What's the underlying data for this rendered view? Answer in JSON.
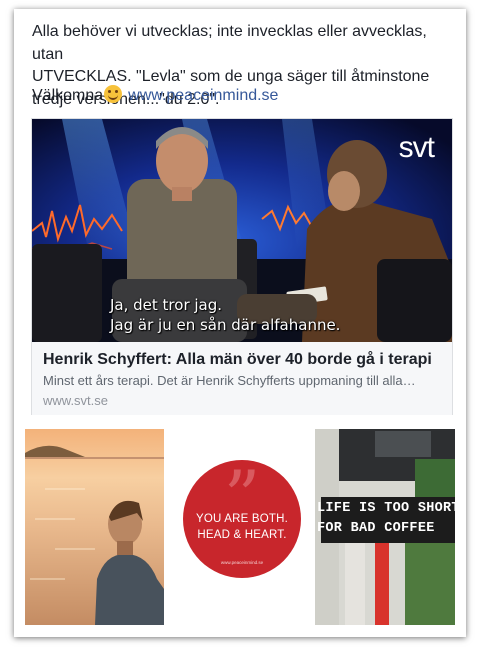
{
  "post": {
    "text_line1": "Alla behöver vi utvecklas; inte invecklas eller avvecklas, utan",
    "text_line2": "UTVECKLAS. \"Levla\" som de unga säger till åtminstone",
    "text_line3": "tredje versionen...\"du 2.0\".",
    "greeting": "Välkomna",
    "link": "www.peaceinmind.se"
  },
  "link_preview": {
    "channel_logo": "svt",
    "subtitle_line1": "Ja, det tror jag.",
    "subtitle_line2": "Jag är ju en sån där alfahanne.",
    "title": "Henrik Schyffert: Alla män över 40 borde gå i terapi",
    "description": "Minst ett års terapi. Det är Henrik Schyfferts uppmaning till alla…",
    "domain": "www.svt.se"
  },
  "thumbnails": {
    "quote_line1": "YOU ARE BOTH.",
    "quote_line2": "HEAD & HEART.",
    "quote_site": "www.peaceinmind.se",
    "sign_line1": "LIFE IS TOO SHORT",
    "sign_line2": "FOR BAD COFFEE"
  },
  "colors": {
    "link": "#365899",
    "quote_red": "#c8262c"
  }
}
